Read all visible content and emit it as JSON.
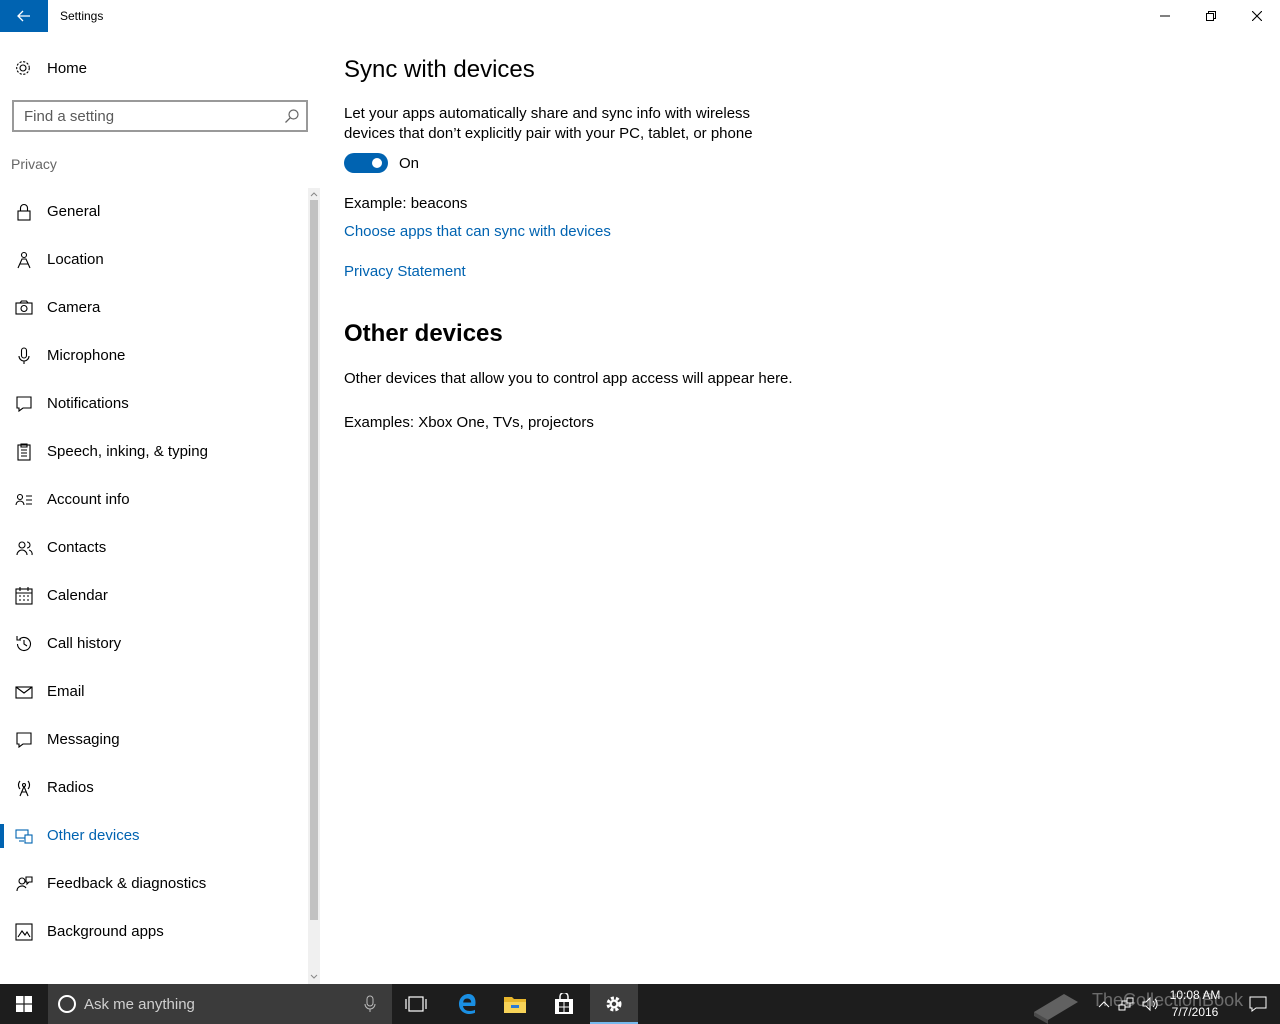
{
  "window": {
    "title": "Settings"
  },
  "sidebar": {
    "home_label": "Home",
    "search_placeholder": "Find a setting",
    "section_label": "Privacy",
    "items": [
      {
        "label": "General",
        "icon": "lock-icon"
      },
      {
        "label": "Location",
        "icon": "location-person-icon"
      },
      {
        "label": "Camera",
        "icon": "camera-icon"
      },
      {
        "label": "Microphone",
        "icon": "microphone-icon"
      },
      {
        "label": "Notifications",
        "icon": "notification-icon"
      },
      {
        "label": "Speech, inking, & typing",
        "icon": "clipboard-icon"
      },
      {
        "label": "Account info",
        "icon": "account-info-icon"
      },
      {
        "label": "Contacts",
        "icon": "contacts-icon"
      },
      {
        "label": "Calendar",
        "icon": "calendar-icon"
      },
      {
        "label": "Call history",
        "icon": "history-icon"
      },
      {
        "label": "Email",
        "icon": "mail-icon"
      },
      {
        "label": "Messaging",
        "icon": "message-icon"
      },
      {
        "label": "Radios",
        "icon": "radio-tower-icon"
      },
      {
        "label": "Other devices",
        "icon": "devices-icon",
        "selected": true
      },
      {
        "label": "Feedback & diagnostics",
        "icon": "feedback-icon"
      },
      {
        "label": "Background apps",
        "icon": "background-apps-icon"
      }
    ]
  },
  "content": {
    "heading": "Sync with devices",
    "description": "Let your apps automatically share and sync info with wireless devices that don’t explicitly pair with your PC, tablet, or phone",
    "toggle_state": "On",
    "example": "Example: beacons",
    "link_choose": "Choose apps that can sync with devices",
    "link_privacy": "Privacy Statement",
    "heading2": "Other devices",
    "other_description": "Other devices that allow you to control app access will appear here.",
    "other_example": "Examples: Xbox One, TVs, projectors"
  },
  "taskbar": {
    "search_placeholder": "Ask me anything",
    "watermark": "TheCollectionBook",
    "time": "10:08 AM",
    "date": "7/7/2016"
  },
  "colors": {
    "accent": "#0063b1",
    "taskbar": "#1d1d1d",
    "taskbar_search": "#3b3b3b"
  }
}
